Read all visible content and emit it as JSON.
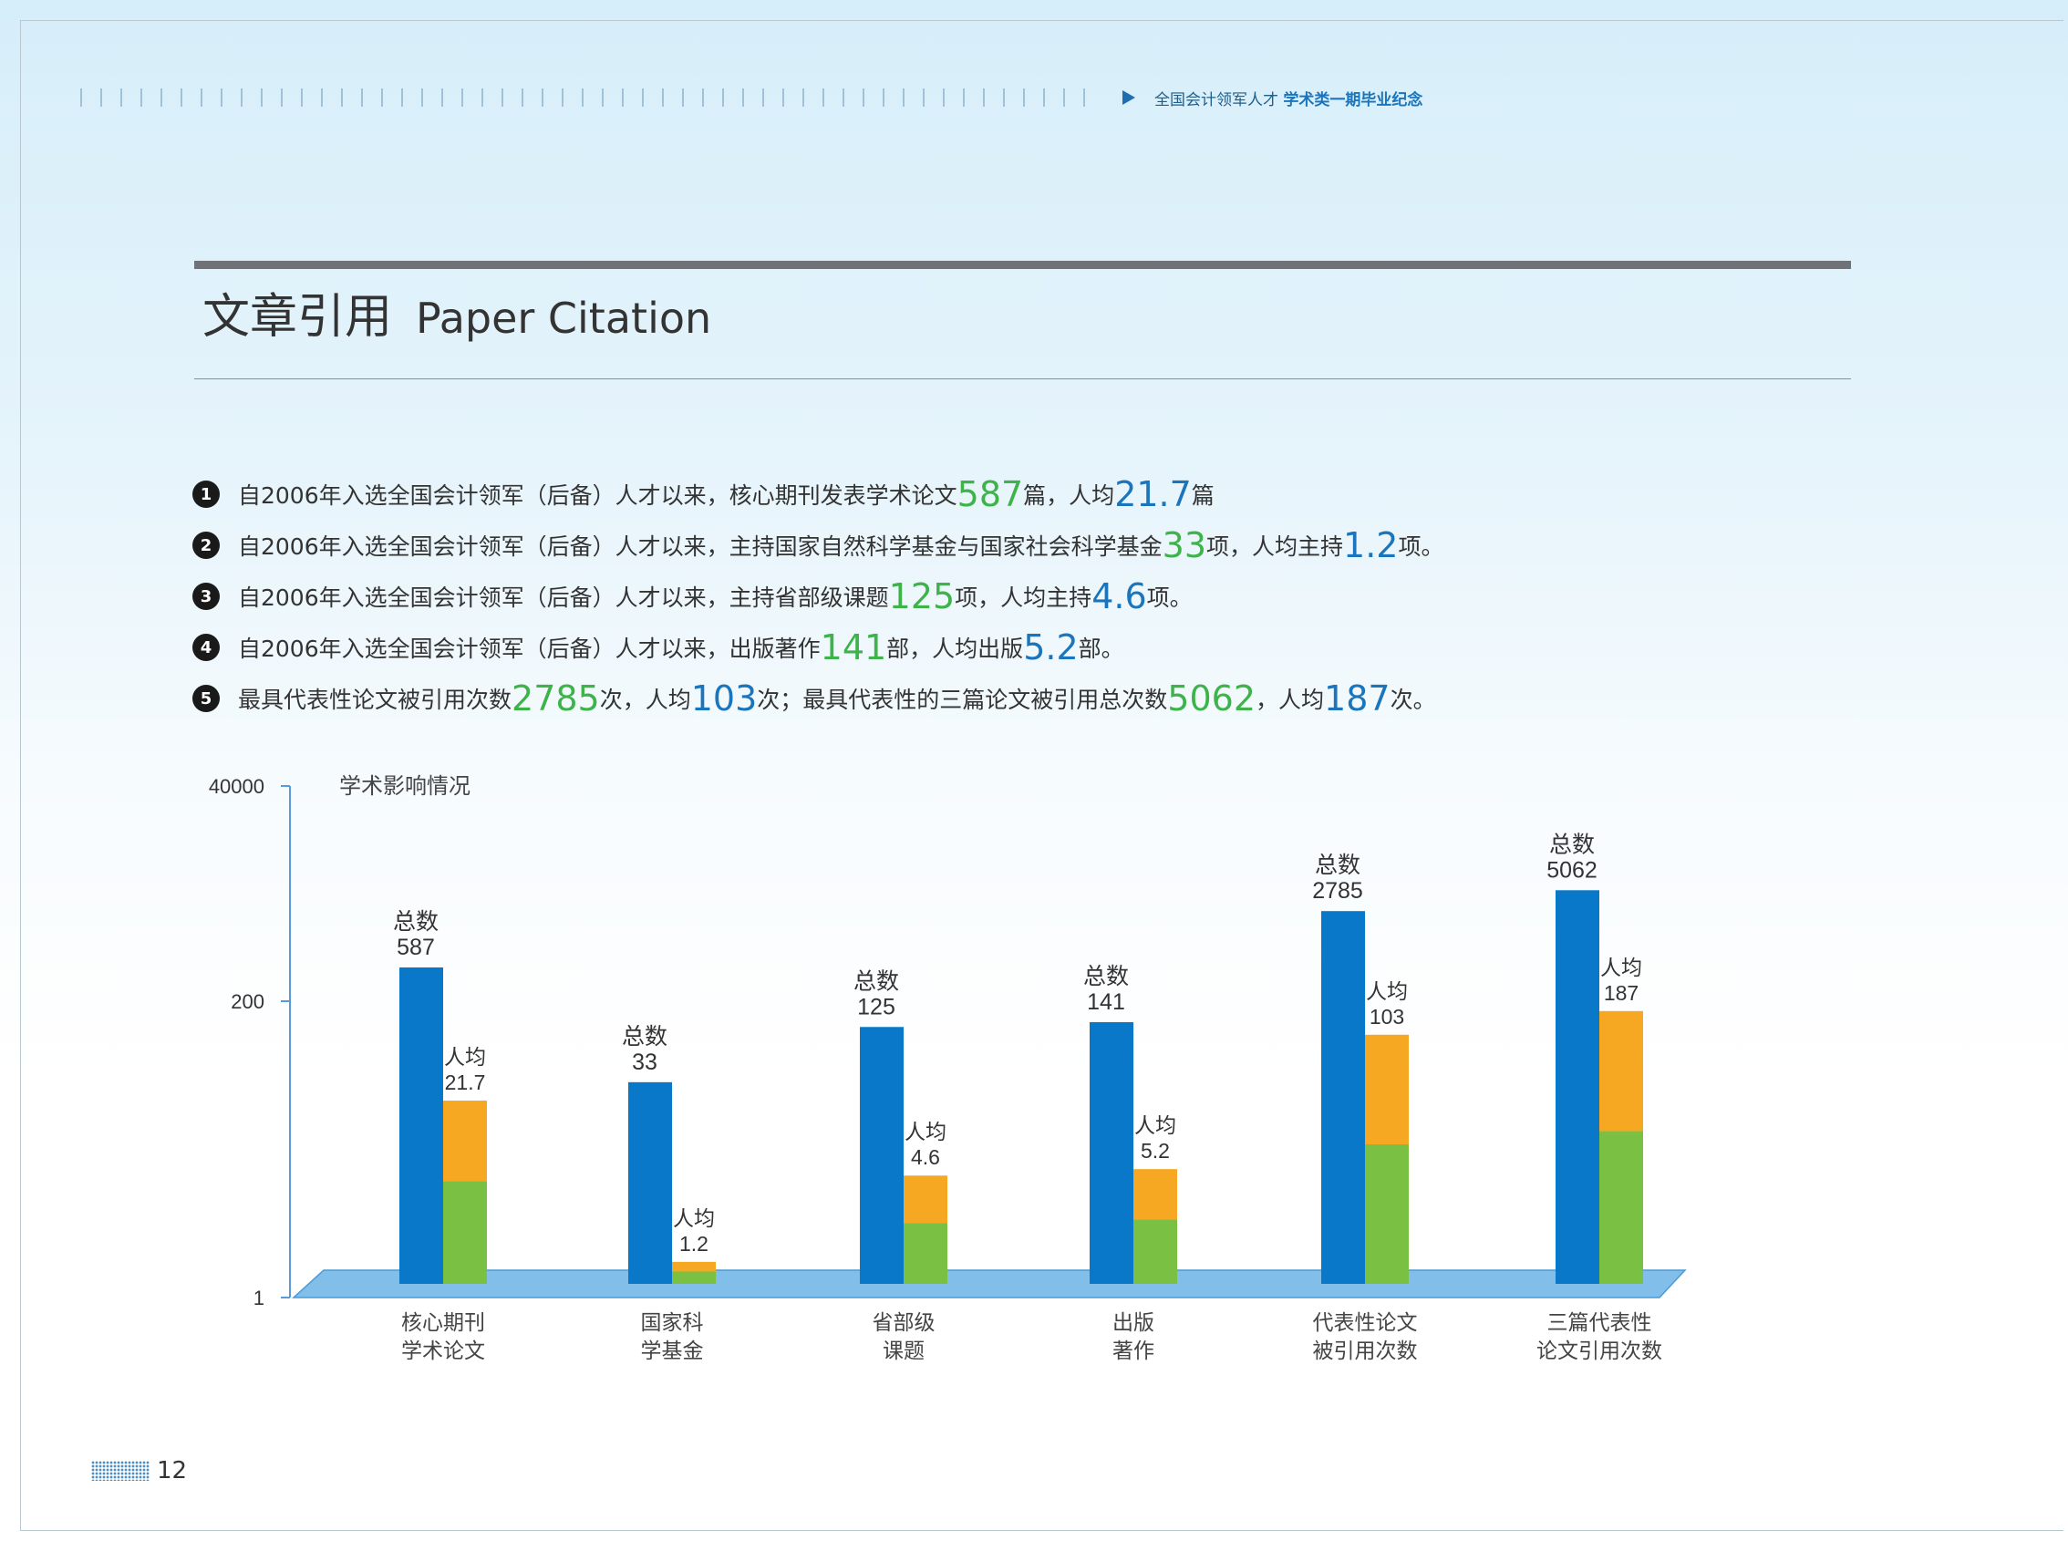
{
  "header": {
    "prefix": "全国会计领军人才",
    "highlight": "学术类一期毕业纪念"
  },
  "section": {
    "title_cn": "文章引用",
    "title_en": "Paper Citation"
  },
  "bullets": [
    {
      "n": "1",
      "segments": [
        {
          "t": "自2006年入选全国会计领军（后备）人才以来，核心期刊发表学术论文",
          "c": ""
        },
        {
          "t": "587",
          "c": "g"
        },
        {
          "t": "篇，人均",
          "c": ""
        },
        {
          "t": "21.7",
          "c": "b"
        },
        {
          "t": "篇",
          "c": ""
        }
      ]
    },
    {
      "n": "2",
      "segments": [
        {
          "t": "自2006年入选全国会计领军（后备）人才以来，主持国家自然科学基金与国家社会科学基金",
          "c": ""
        },
        {
          "t": "33",
          "c": "g"
        },
        {
          "t": "项，人均主持",
          "c": ""
        },
        {
          "t": "1.2",
          "c": "b"
        },
        {
          "t": "项。",
          "c": ""
        }
      ]
    },
    {
      "n": "3",
      "segments": [
        {
          "t": "自2006年入选全国会计领军（后备）人才以来，主持省部级课题",
          "c": ""
        },
        {
          "t": "125",
          "c": "g"
        },
        {
          "t": "项，人均主持",
          "c": ""
        },
        {
          "t": "4.6",
          "c": "b"
        },
        {
          "t": "项。",
          "c": ""
        }
      ]
    },
    {
      "n": "4",
      "segments": [
        {
          "t": "自2006年入选全国会计领军（后备）人才以来，出版著作",
          "c": ""
        },
        {
          "t": "141",
          "c": "g"
        },
        {
          "t": "部，人均出版",
          "c": ""
        },
        {
          "t": "5.2",
          "c": "b"
        },
        {
          "t": "部。",
          "c": ""
        }
      ]
    },
    {
      "n": "5",
      "segments": [
        {
          "t": "最具代表性论文被引用次数",
          "c": ""
        },
        {
          "t": "2785",
          "c": "g"
        },
        {
          "t": "次，人均",
          "c": ""
        },
        {
          "t": "103",
          "c": "b"
        },
        {
          "t": "次；最具代表性的三篇论文被引用总次数",
          "c": ""
        },
        {
          "t": "5062",
          "c": "g"
        },
        {
          "t": "，人均",
          "c": ""
        },
        {
          "t": "187",
          "c": "b"
        },
        {
          "t": "次。",
          "c": ""
        }
      ]
    }
  ],
  "chart_data": {
    "type": "bar",
    "title": "学术影响情况",
    "y_ticks": [
      "40000",
      "200",
      "1"
    ],
    "ylim": [
      1,
      40000
    ],
    "scale": "log",
    "categories": [
      "核心期刊\n学术论文",
      "国家科\n学基金",
      "省部级\n课题",
      "出版\n著作",
      "代表性论文\n被引用次数",
      "三篇代表性\n论文引用次数"
    ],
    "series": [
      {
        "name": "总数",
        "values": [
          587,
          33,
          125,
          141,
          2785,
          5062
        ]
      },
      {
        "name": "人均",
        "values": [
          21.7,
          1.2,
          4.6,
          5.2,
          103,
          187
        ]
      }
    ],
    "total_label": "总数",
    "avg_label": "人均",
    "colors": {
      "total": "#0a78c8",
      "avg_top": "#f7a823",
      "avg_bottom": "#7ac143",
      "floor": "#6cb3e6",
      "axis": "#5a9bd5"
    }
  },
  "footer": {
    "page_number": "12"
  }
}
